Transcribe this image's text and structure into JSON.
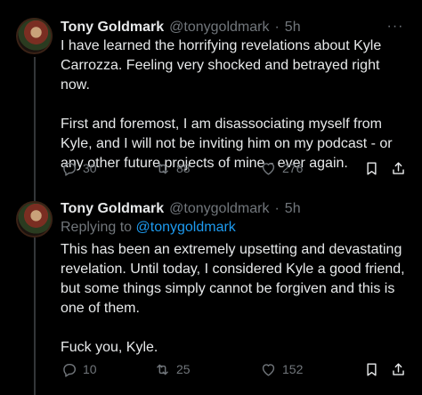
{
  "thread": [
    {
      "author": {
        "name": "Tony Goldmark",
        "handle": "@tonygoldmark",
        "separator": "·",
        "time": "5h"
      },
      "more_label": "···",
      "paragraphs": [
        "I have learned the horrifying revelations about Kyle Carrozza. Feeling very shocked and betrayed right now.",
        "First and foremost, I am disassociating myself from Kyle, and I will not be inviting him on my podcast - or any other future projects of mine - ever again."
      ],
      "stats": {
        "replies": "30",
        "retweets": "88",
        "likes": "276"
      }
    },
    {
      "author": {
        "name": "Tony Goldmark",
        "handle": "@tonygoldmark",
        "separator": "·",
        "time": "5h"
      },
      "replying_prefix": "Replying to",
      "replying_to": "@tonygoldmark",
      "paragraphs": [
        "This has been an extremely upsetting and devastating revelation. Until today, I considered Kyle a good friend, but some things simply cannot be forgiven and this is one of them.",
        "Fuck you, Kyle."
      ],
      "stats": {
        "replies": "10",
        "retweets": "25",
        "likes": "152"
      }
    }
  ],
  "icons": {
    "reply": "reply-bubble-icon",
    "retweet": "retweet-icon",
    "like": "heart-icon",
    "bookmark": "bookmark-icon",
    "share": "share-icon"
  },
  "colors": {
    "background": "#000000",
    "text": "#e7e9ea",
    "muted": "#71767b",
    "link": "#1d9bf0",
    "thread_line": "#333639"
  }
}
